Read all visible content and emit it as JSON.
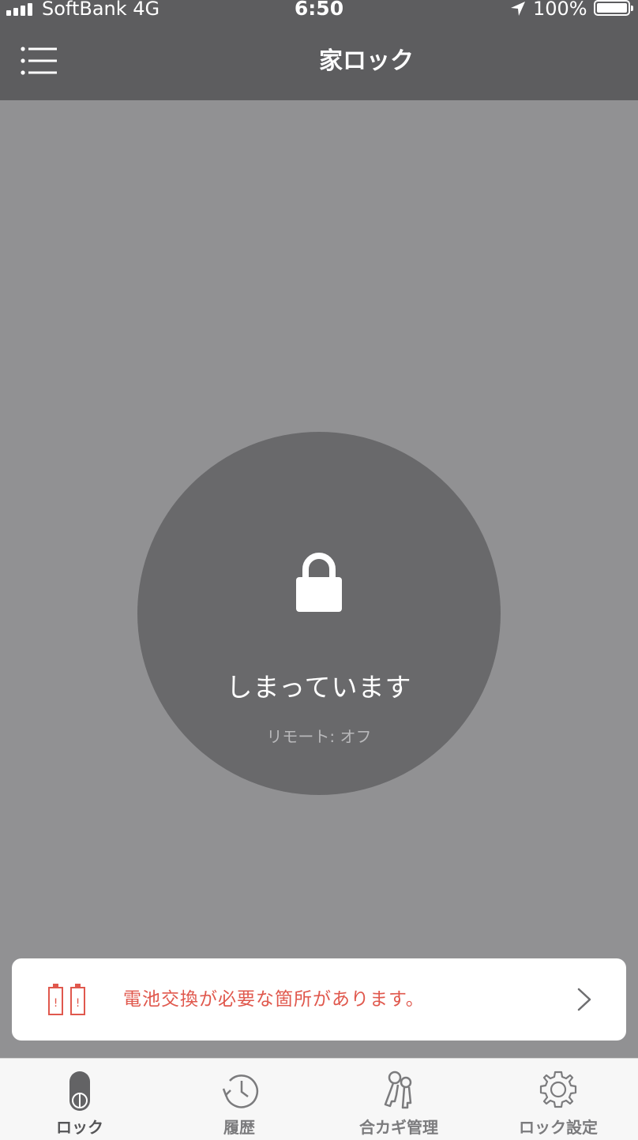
{
  "status_bar": {
    "carrier": "SoftBank   4G",
    "time": "6:50",
    "battery": "100%"
  },
  "nav": {
    "title": "家ロック"
  },
  "lock": {
    "state": "しまっています",
    "remote": "リモート: オフ"
  },
  "alert": {
    "message": "電池交換が必要な箇所があります。"
  },
  "tabs": [
    {
      "label": "ロック",
      "icon": "lock-knob-icon",
      "active": true
    },
    {
      "label": "履歴",
      "icon": "history-icon",
      "active": false
    },
    {
      "label": "合カギ管理",
      "icon": "keys-icon",
      "active": false
    },
    {
      "label": "ロック設定",
      "icon": "gear-icon",
      "active": false
    }
  ],
  "colors": {
    "nav_bg": "#5d5d5f",
    "screen_bg": "#919193",
    "circle_bg": "#69696b",
    "alert_red": "#e0584d"
  }
}
